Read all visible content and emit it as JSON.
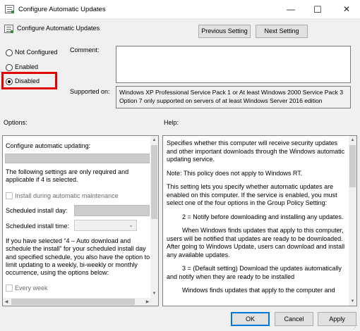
{
  "window": {
    "title": "Configure Automatic Updates",
    "close_glyph": "✕",
    "maximize_glyph": "☐",
    "minimize_glyph": "—"
  },
  "header": {
    "setting_name": "Configure Automatic Updates",
    "previous_label": "Previous Setting",
    "next_label": "Next Setting"
  },
  "state": {
    "options": [
      {
        "label": "Not Configured",
        "selected": false
      },
      {
        "label": "Enabled",
        "selected": false
      },
      {
        "label": "Disabled",
        "selected": true
      }
    ]
  },
  "comment": {
    "label": "Comment:",
    "value": ""
  },
  "supported": {
    "label": "Supported on:",
    "value": "Windows XP Professional Service Pack 1 or At least Windows 2000 Service Pack 3 Option 7 only supported on servers of at least Windows Server 2016 edition"
  },
  "options_pane": {
    "title": "Options:",
    "configure_label": "Configure automatic updating:",
    "note": "The following settings are only required and applicable if 4 is selected.",
    "install_maintenance": "Install during automatic maintenance",
    "scheduled_day_label": "Scheduled install day:",
    "scheduled_time_label": "Scheduled install time:",
    "paragraph": "If you have selected “4 – Auto download and schedule the install” for your scheduled install day and specified schedule, you also have the option to limit updating to a weekly, bi-weekly or monthly occurrence, using the options below:",
    "every_week": "Every week"
  },
  "help_pane": {
    "title": "Help:",
    "paragraphs": [
      "Specifies whether this computer will receive security updates and other important downloads through the Windows automatic updating service.",
      "Note: This policy does not apply to Windows RT.",
      "This setting lets you specify whether automatic updates are enabled on this computer. If the service is enabled, you must select one of the four options in the Group Policy Setting:",
      "2 = Notify before downloading and installing any updates.",
      "When Windows finds updates that apply to this computer, users will be notified that updates are ready to be downloaded. After going to Windows Update, users can download and install any available updates.",
      "3 = (Default setting) Download the updates automatically and notify when they are ready to be installed",
      "Windows finds updates that apply to the computer and"
    ]
  },
  "footer": {
    "ok": "OK",
    "cancel": "Cancel",
    "apply": "Apply"
  },
  "colors": {
    "highlight": "#e00000",
    "accent": "#0078d7"
  }
}
